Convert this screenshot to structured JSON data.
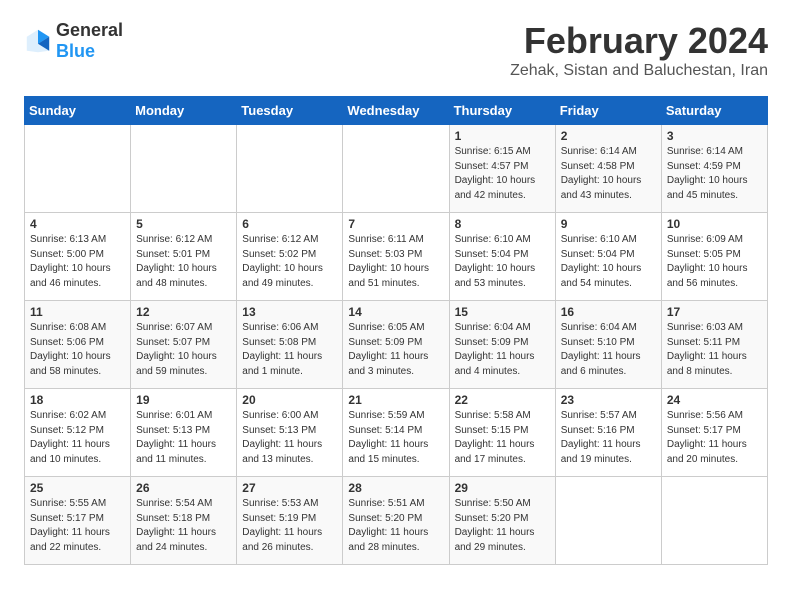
{
  "header": {
    "logo": {
      "text_general": "General",
      "text_blue": "Blue"
    },
    "month_year": "February 2024",
    "location": "Zehak, Sistan and Baluchestan, Iran"
  },
  "weekdays": [
    "Sunday",
    "Monday",
    "Tuesday",
    "Wednesday",
    "Thursday",
    "Friday",
    "Saturday"
  ],
  "rows": [
    [
      {
        "day": "",
        "content": ""
      },
      {
        "day": "",
        "content": ""
      },
      {
        "day": "",
        "content": ""
      },
      {
        "day": "",
        "content": ""
      },
      {
        "day": "1",
        "content": "Sunrise: 6:15 AM\nSunset: 4:57 PM\nDaylight: 10 hours\nand 42 minutes."
      },
      {
        "day": "2",
        "content": "Sunrise: 6:14 AM\nSunset: 4:58 PM\nDaylight: 10 hours\nand 43 minutes."
      },
      {
        "day": "3",
        "content": "Sunrise: 6:14 AM\nSunset: 4:59 PM\nDaylight: 10 hours\nand 45 minutes."
      }
    ],
    [
      {
        "day": "4",
        "content": "Sunrise: 6:13 AM\nSunset: 5:00 PM\nDaylight: 10 hours\nand 46 minutes."
      },
      {
        "day": "5",
        "content": "Sunrise: 6:12 AM\nSunset: 5:01 PM\nDaylight: 10 hours\nand 48 minutes."
      },
      {
        "day": "6",
        "content": "Sunrise: 6:12 AM\nSunset: 5:02 PM\nDaylight: 10 hours\nand 49 minutes."
      },
      {
        "day": "7",
        "content": "Sunrise: 6:11 AM\nSunset: 5:03 PM\nDaylight: 10 hours\nand 51 minutes."
      },
      {
        "day": "8",
        "content": "Sunrise: 6:10 AM\nSunset: 5:04 PM\nDaylight: 10 hours\nand 53 minutes."
      },
      {
        "day": "9",
        "content": "Sunrise: 6:10 AM\nSunset: 5:04 PM\nDaylight: 10 hours\nand 54 minutes."
      },
      {
        "day": "10",
        "content": "Sunrise: 6:09 AM\nSunset: 5:05 PM\nDaylight: 10 hours\nand 56 minutes."
      }
    ],
    [
      {
        "day": "11",
        "content": "Sunrise: 6:08 AM\nSunset: 5:06 PM\nDaylight: 10 hours\nand 58 minutes."
      },
      {
        "day": "12",
        "content": "Sunrise: 6:07 AM\nSunset: 5:07 PM\nDaylight: 10 hours\nand 59 minutes."
      },
      {
        "day": "13",
        "content": "Sunrise: 6:06 AM\nSunset: 5:08 PM\nDaylight: 11 hours\nand 1 minute."
      },
      {
        "day": "14",
        "content": "Sunrise: 6:05 AM\nSunset: 5:09 PM\nDaylight: 11 hours\nand 3 minutes."
      },
      {
        "day": "15",
        "content": "Sunrise: 6:04 AM\nSunset: 5:09 PM\nDaylight: 11 hours\nand 4 minutes."
      },
      {
        "day": "16",
        "content": "Sunrise: 6:04 AM\nSunset: 5:10 PM\nDaylight: 11 hours\nand 6 minutes."
      },
      {
        "day": "17",
        "content": "Sunrise: 6:03 AM\nSunset: 5:11 PM\nDaylight: 11 hours\nand 8 minutes."
      }
    ],
    [
      {
        "day": "18",
        "content": "Sunrise: 6:02 AM\nSunset: 5:12 PM\nDaylight: 11 hours\nand 10 minutes."
      },
      {
        "day": "19",
        "content": "Sunrise: 6:01 AM\nSunset: 5:13 PM\nDaylight: 11 hours\nand 11 minutes."
      },
      {
        "day": "20",
        "content": "Sunrise: 6:00 AM\nSunset: 5:13 PM\nDaylight: 11 hours\nand 13 minutes."
      },
      {
        "day": "21",
        "content": "Sunrise: 5:59 AM\nSunset: 5:14 PM\nDaylight: 11 hours\nand 15 minutes."
      },
      {
        "day": "22",
        "content": "Sunrise: 5:58 AM\nSunset: 5:15 PM\nDaylight: 11 hours\nand 17 minutes."
      },
      {
        "day": "23",
        "content": "Sunrise: 5:57 AM\nSunset: 5:16 PM\nDaylight: 11 hours\nand 19 minutes."
      },
      {
        "day": "24",
        "content": "Sunrise: 5:56 AM\nSunset: 5:17 PM\nDaylight: 11 hours\nand 20 minutes."
      }
    ],
    [
      {
        "day": "25",
        "content": "Sunrise: 5:55 AM\nSunset: 5:17 PM\nDaylight: 11 hours\nand 22 minutes."
      },
      {
        "day": "26",
        "content": "Sunrise: 5:54 AM\nSunset: 5:18 PM\nDaylight: 11 hours\nand 24 minutes."
      },
      {
        "day": "27",
        "content": "Sunrise: 5:53 AM\nSunset: 5:19 PM\nDaylight: 11 hours\nand 26 minutes."
      },
      {
        "day": "28",
        "content": "Sunrise: 5:51 AM\nSunset: 5:20 PM\nDaylight: 11 hours\nand 28 minutes."
      },
      {
        "day": "29",
        "content": "Sunrise: 5:50 AM\nSunset: 5:20 PM\nDaylight: 11 hours\nand 29 minutes."
      },
      {
        "day": "",
        "content": ""
      },
      {
        "day": "",
        "content": ""
      }
    ]
  ]
}
